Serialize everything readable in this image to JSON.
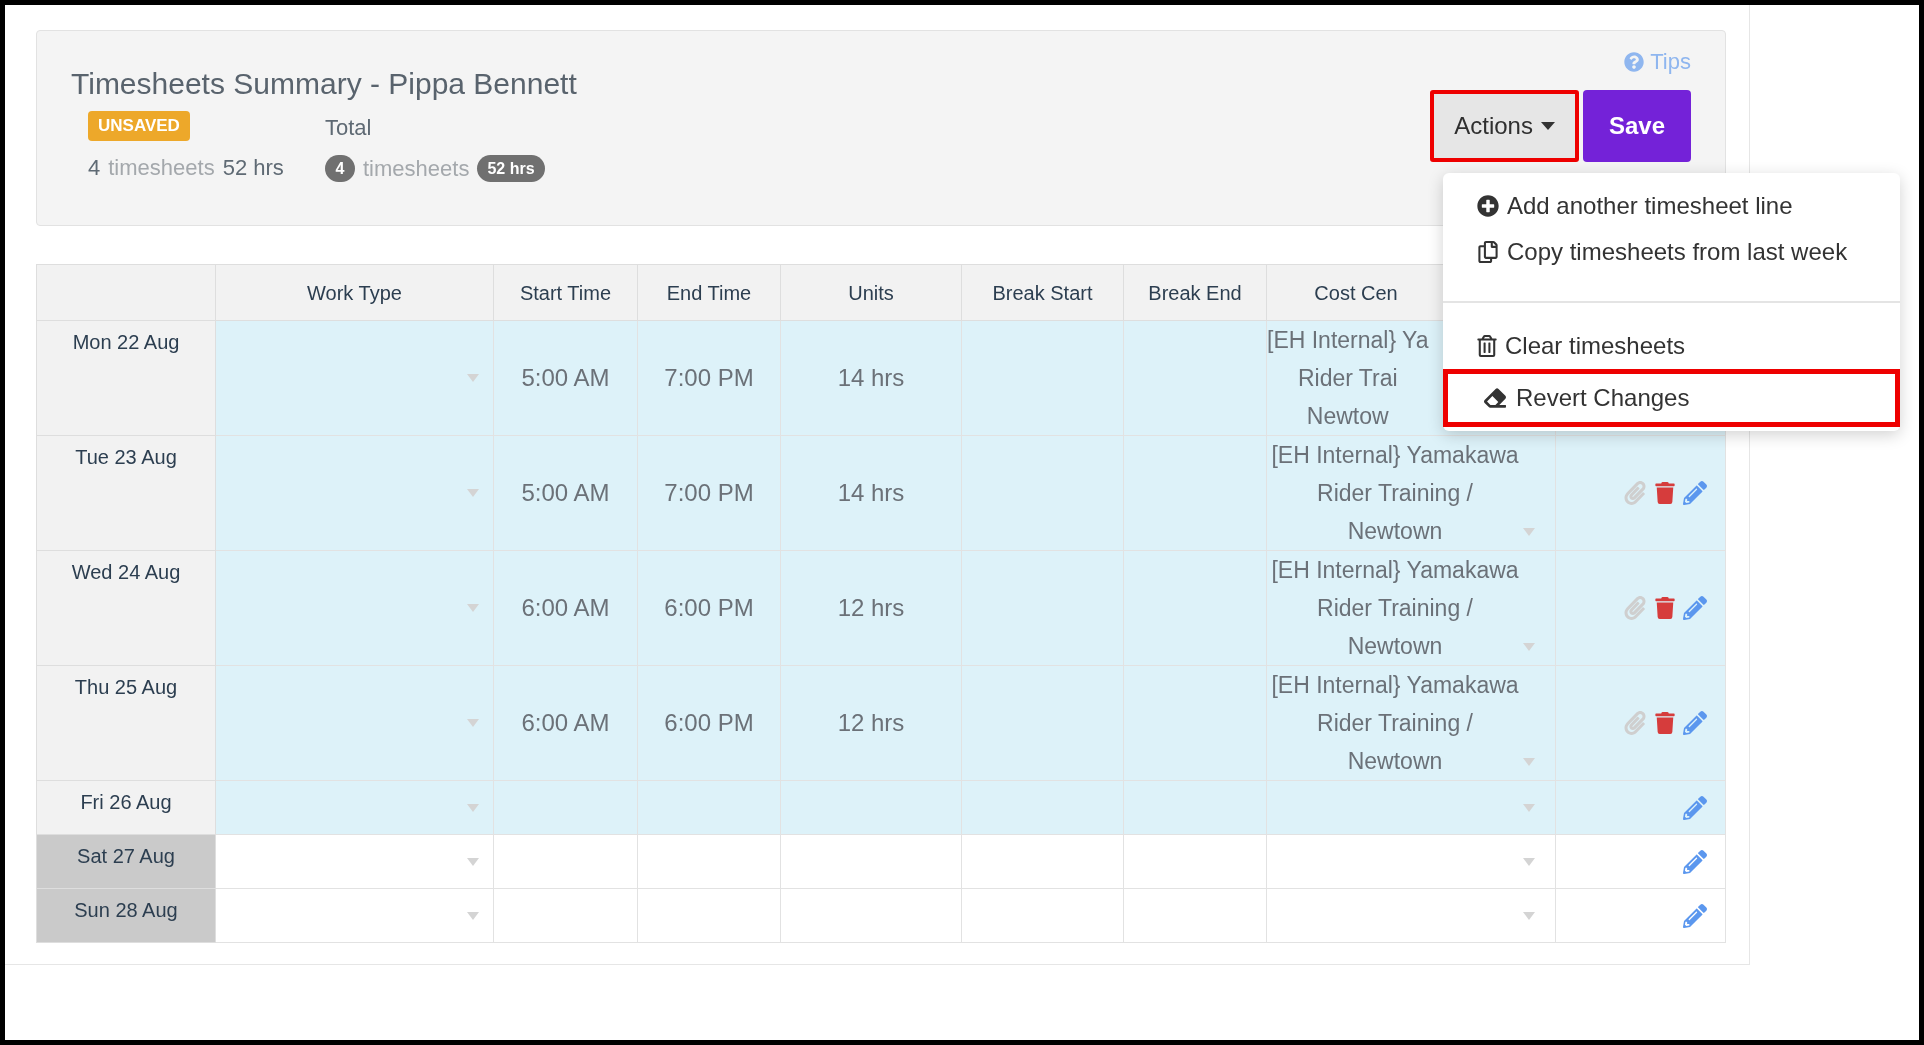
{
  "header": {
    "title": "Timesheets Summary - Pippa Bennett",
    "status_badge": "UNSAVED",
    "summary": {
      "count": "4",
      "count_label": "timesheets",
      "hours": "52 hrs"
    },
    "total": {
      "label": "Total",
      "count": "4",
      "count_label": "timesheets",
      "hours": "52 hrs"
    }
  },
  "tips": "Tips",
  "actions_button": {
    "label": "Actions",
    "highlighted": true
  },
  "save_button": "Save",
  "actions_menu": {
    "groups": [
      [
        {
          "kind": "add",
          "label": "Add another timesheet line",
          "highlighted": false
        },
        {
          "kind": "copy",
          "label": "Copy timesheets from last week",
          "highlighted": false
        }
      ],
      [
        {
          "kind": "clear",
          "label": "Clear timesheets",
          "highlighted": false
        },
        {
          "kind": "revert",
          "label": "Revert Changes",
          "highlighted": true
        }
      ]
    ]
  },
  "table": {
    "columns": [
      {
        "label": "Work Type",
        "covered": false
      },
      {
        "label": "Start Time",
        "covered": false
      },
      {
        "label": "End Time",
        "covered": false
      },
      {
        "label": "Units",
        "covered": false
      },
      {
        "label": "Break Start",
        "covered": false
      },
      {
        "label": "Break End",
        "covered": false
      },
      {
        "label": "Cost Cen",
        "covered": true
      }
    ],
    "rows": [
      {
        "date": "Mon 22 Aug",
        "weekend": false,
        "filled": true,
        "tall": true,
        "start": "5:00 AM",
        "end": "7:00 PM",
        "units": "14 hrs",
        "cost_centre": [
          "[EH Internal} Ya",
          "Rider Trai",
          "Newtow"
        ],
        "cost_covered": true,
        "removable": false
      },
      {
        "date": "Tue 23 Aug",
        "weekend": false,
        "filled": true,
        "tall": true,
        "start": "5:00 AM",
        "end": "7:00 PM",
        "units": "14 hrs",
        "cost_centre": [
          "[EH Internal} Yamakawa",
          "Rider Training /",
          "Newtown"
        ],
        "cost_covered": false,
        "removable": true
      },
      {
        "date": "Wed 24 Aug",
        "weekend": false,
        "filled": true,
        "tall": true,
        "start": "6:00 AM",
        "end": "6:00 PM",
        "units": "12 hrs",
        "cost_centre": [
          "[EH Internal} Yamakawa",
          "Rider Training /",
          "Newtown"
        ],
        "cost_covered": false,
        "removable": true
      },
      {
        "date": "Thu 25 Aug",
        "weekend": false,
        "filled": true,
        "tall": true,
        "start": "6:00 AM",
        "end": "6:00 PM",
        "units": "12 hrs",
        "cost_centre": [
          "[EH Internal} Yamakawa",
          "Rider Training /",
          "Newtown"
        ],
        "cost_covered": false,
        "removable": true
      },
      {
        "date": "Fri 26 Aug",
        "weekend": false,
        "filled": true,
        "tall": false,
        "removable": false
      },
      {
        "date": "Sat 27 Aug",
        "weekend": true,
        "filled": false,
        "tall": false,
        "removable": false
      },
      {
        "date": "Sun 28 Aug",
        "weekend": true,
        "filled": false,
        "tall": false,
        "removable": false
      }
    ]
  }
}
